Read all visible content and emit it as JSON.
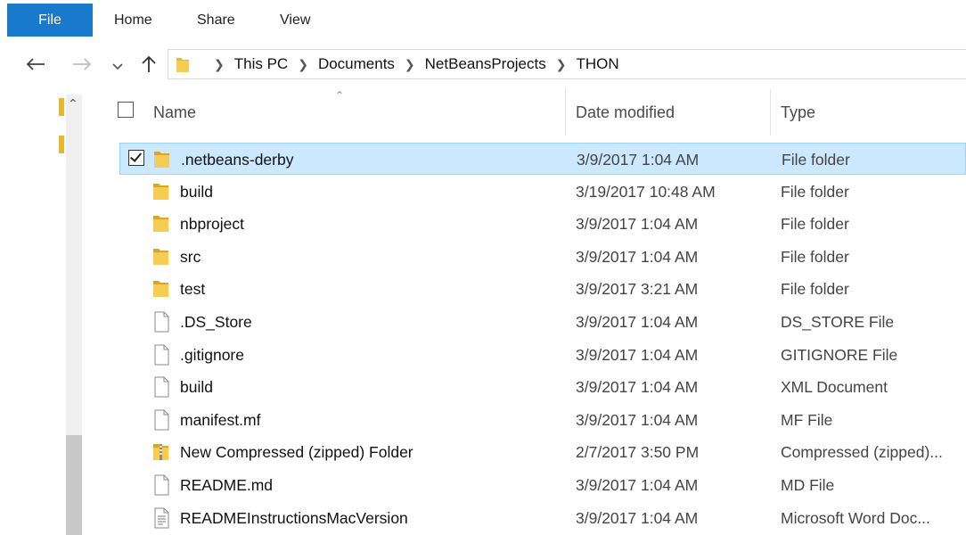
{
  "ribbon": {
    "file": "File",
    "tabs": [
      "Home",
      "Share",
      "View"
    ]
  },
  "nav": {
    "back_icon": "arrow-left-icon",
    "forward_icon": "arrow-right-icon",
    "recent_icon": "chevron-down-icon",
    "up_icon": "arrow-up-icon",
    "breadcrumbs": [
      "This PC",
      "Documents",
      "NetBeansProjects",
      "THON"
    ]
  },
  "columns": {
    "name": "Name",
    "date": "Date modified",
    "type": "Type"
  },
  "files": [
    {
      "name": ".netbeans-derby",
      "date": "3/9/2017 1:04 AM",
      "type": "File folder",
      "icon": "folder-icon",
      "selected": true
    },
    {
      "name": "build",
      "date": "3/19/2017 10:48 AM",
      "type": "File folder",
      "icon": "folder-icon"
    },
    {
      "name": "nbproject",
      "date": "3/9/2017 1:04 AM",
      "type": "File folder",
      "icon": "folder-icon"
    },
    {
      "name": "src",
      "date": "3/9/2017 1:04 AM",
      "type": "File folder",
      "icon": "folder-icon"
    },
    {
      "name": "test",
      "date": "3/9/2017 3:21 AM",
      "type": "File folder",
      "icon": "folder-icon"
    },
    {
      "name": ".DS_Store",
      "date": "3/9/2017 1:04 AM",
      "type": "DS_STORE File",
      "icon": "file-icon"
    },
    {
      "name": ".gitignore",
      "date": "3/9/2017 1:04 AM",
      "type": "GITIGNORE File",
      "icon": "file-icon"
    },
    {
      "name": "build",
      "date": "3/9/2017 1:04 AM",
      "type": "XML Document",
      "icon": "file-icon"
    },
    {
      "name": "manifest.mf",
      "date": "3/9/2017 1:04 AM",
      "type": "MF File",
      "icon": "file-icon"
    },
    {
      "name": "New Compressed (zipped) Folder",
      "date": "2/7/2017 3:50 PM",
      "type": "Compressed (zipped)...",
      "icon": "zip-folder-icon"
    },
    {
      "name": "README.md",
      "date": "3/9/2017 1:04 AM",
      "type": "MD File",
      "icon": "file-icon"
    },
    {
      "name": "READMEInstructionsMacVersion",
      "date": "3/9/2017 1:04 AM",
      "type": "Microsoft Word Doc...",
      "icon": "word-document-icon"
    }
  ],
  "colors": {
    "accent": "#1979ca",
    "selection_bg": "#cce8ff",
    "selection_border": "#99d1ff",
    "folder": "#e8b730"
  }
}
